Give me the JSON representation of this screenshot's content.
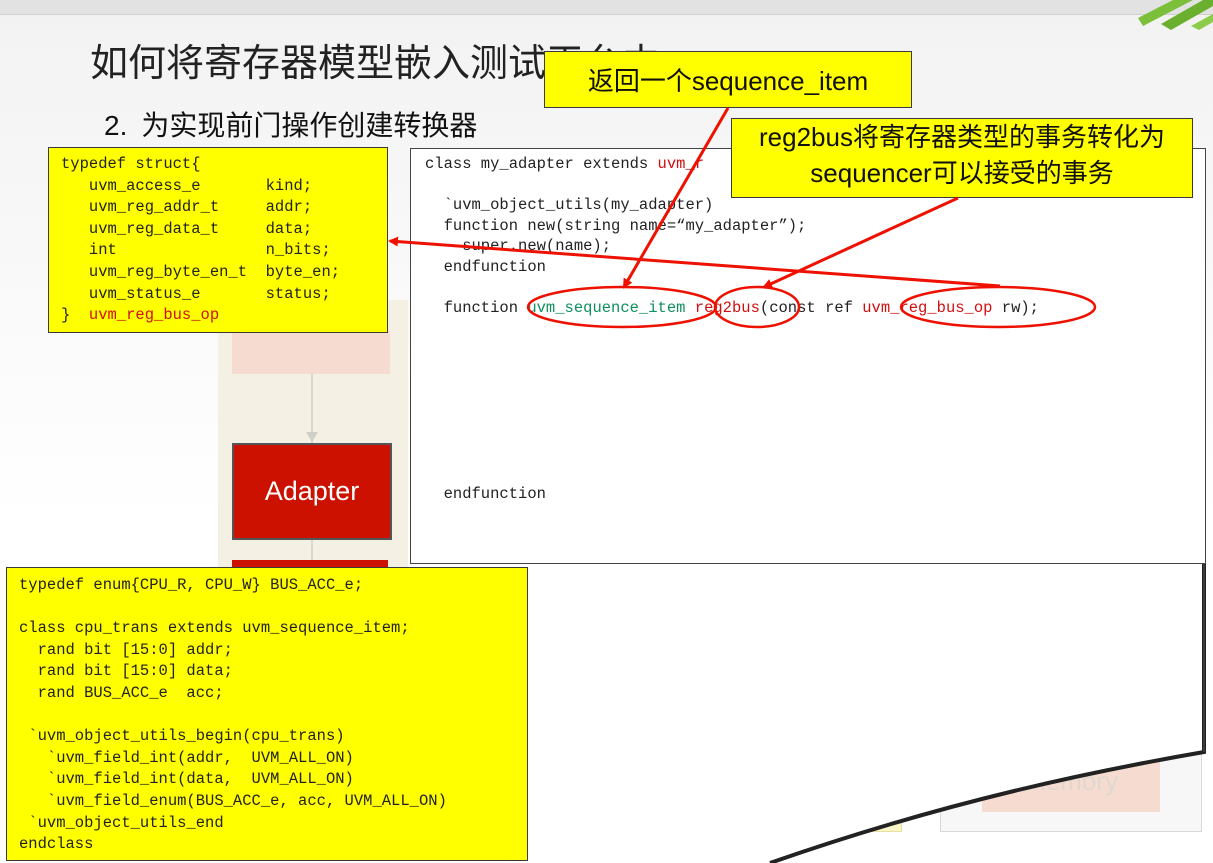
{
  "slide": {
    "title": "如何将寄存器模型嵌入测试平台中",
    "subtitle_num": "2.",
    "subtitle": "为实现前门操作创建转换器"
  },
  "diagram": {
    "adapter_label": "Adapter",
    "memory_label": "memory"
  },
  "callouts": {
    "returns": "返回一个sequence_item",
    "reg2bus": "reg2bus将寄存器类型的事务转化为sequencer可以接受的事务"
  },
  "struct_code": {
    "lines": [
      "typedef struct{",
      "   uvm_access_e       kind;",
      "   uvm_reg_addr_t     addr;",
      "   uvm_reg_data_t     data;",
      "   int                n_bits;",
      "   uvm_reg_byte_en_t  byte_en;",
      "   uvm_status_e       status;"
    ],
    "last_brace": "}  ",
    "type_name": "uvm_reg_bus_op"
  },
  "adapter_code": {
    "line1_prefix": "class my_adapter extends ",
    "line1_red": "uvm_r",
    "blank": "",
    "utils": "  `uvm_object_utils(my_adapter)",
    "new_fn": "  function new(string name=“my_adapter”);",
    "super_new": "    super.new(name);",
    "endfunction1": "  endfunction",
    "fn_kw": "  function ",
    "ret_type": "uvm_sequence_item",
    "fn_name": "reg2bus",
    "args_prefix": "(const ref ",
    "arg_type": "uvm_reg_bus_op",
    "args_suffix": " rw);",
    "endfunction2": "  endfunction"
  },
  "enum_code": {
    "text": "typedef enum{CPU_R, CPU_W} BUS_ACC_e;\n\nclass cpu_trans extends uvm_sequence_item;\n  rand bit [15:0] addr;\n  rand bit [15:0] data;\n  rand BUS_ACC_e  acc;\n\n `uvm_object_utils_begin(cpu_trans)\n   `uvm_field_int(addr,  UVM_ALL_ON)\n   `uvm_field_int(data,  UVM_ALL_ON)\n   `uvm_field_enum(BUS_ACC_e, acc, UVM_ALL_ON)\n `uvm_object_utils_end\nendclass"
  },
  "colors": {
    "highlight": "#ffff00",
    "adapter": "#cc1100",
    "annotation": "#ee1100",
    "keyword_red": "#d01010",
    "type_green": "#109060"
  }
}
